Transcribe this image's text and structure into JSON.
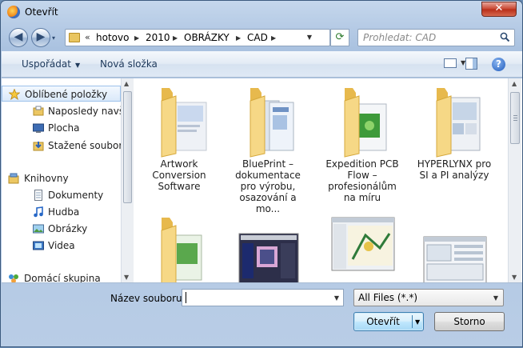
{
  "window": {
    "title": "Otevřít",
    "close_glyph": "✕"
  },
  "nav": {
    "back_glyph": "◀",
    "forward_glyph": "▶",
    "recent_glyph": "▾",
    "address": {
      "overflow": "«",
      "crumbs": [
        "hotovo",
        "2010",
        "OBRÁZKY",
        "CAD"
      ],
      "separator": "▶",
      "dropdown_glyph": "▼"
    },
    "refresh_glyph": "⟳",
    "search_placeholder": "Prohledat: CAD"
  },
  "toolbar": {
    "organize_label": "Uspořádat",
    "organize_caret": "▼",
    "new_folder_label": "Nová složka",
    "view_caret": "▼",
    "help_glyph": "?"
  },
  "sidebar": {
    "items": [
      {
        "label": "Oblíbené položky",
        "icon": "star-icon"
      },
      {
        "label": "Naposledy navštívené",
        "icon": "recent-places-icon"
      },
      {
        "label": "Plocha",
        "icon": "desktop-icon"
      },
      {
        "label": "Stažené soubory",
        "icon": "downloads-icon"
      },
      {
        "label": "Knihovny",
        "icon": "libraries-icon"
      },
      {
        "label": "Dokumenty",
        "icon": "documents-icon"
      },
      {
        "label": "Hudba",
        "icon": "music-icon"
      },
      {
        "label": "Obrázky",
        "icon": "pictures-icon"
      },
      {
        "label": "Videa",
        "icon": "videos-icon"
      },
      {
        "label": "Domácí skupina",
        "icon": "homegroup-icon"
      }
    ],
    "scroll_up": "▲",
    "scroll_down": "▼"
  },
  "files": {
    "items": [
      {
        "label": "Artwork Conversion Software",
        "kind": "folder"
      },
      {
        "label": "BluePrint – dokumentace pro výrobu, osazování a mo...",
        "kind": "folder"
      },
      {
        "label": "Expedition PCB Flow – profesionálům na míru",
        "kind": "folder"
      },
      {
        "label": "HYPERLYNX pro SI a PI analýzy",
        "kind": "folder"
      },
      {
        "label": "",
        "kind": "folder"
      },
      {
        "label": "",
        "kind": "image"
      },
      {
        "label": "",
        "kind": "image"
      },
      {
        "label": "",
        "kind": "image"
      }
    ],
    "scroll_up": "▲",
    "scroll_down": "▼"
  },
  "footer": {
    "filename_label": "Název souboru:",
    "filename_value": "",
    "filename_dd": "▼",
    "filetype_value": "All Files (*.*)",
    "filetype_dd": "▼",
    "open_label": "Otevřít",
    "open_caret": "▼",
    "cancel_label": "Storno"
  },
  "colors": {
    "selection": "#dae9fa",
    "folder": "#f3d27a",
    "accent": "#1f5bbd"
  }
}
